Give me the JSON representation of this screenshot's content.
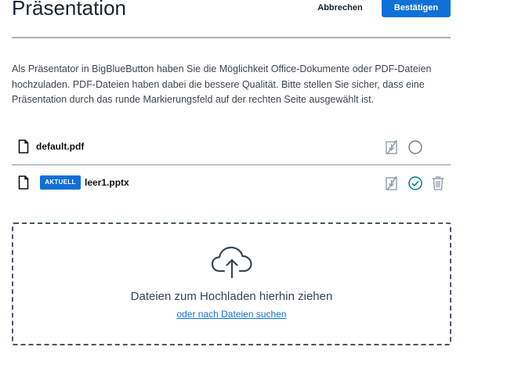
{
  "header": {
    "title": "Präsentation",
    "cancel_label": "Abbrechen",
    "confirm_label": "Bestätigen"
  },
  "intro_text": "Als Präsentator in BigBlueButton haben Sie die Möglichkeit Office-Dokumente oder PDF-Dateien hochzuladen. PDF-Dateien haben dabei die bessere Qualität. Bitte stellen Sie sicher, dass eine Präsentation durch das runde Markierungsfeld auf der rechten Seite ausgewählt ist.",
  "files": [
    {
      "name": "default.pdf",
      "current": false,
      "icons": [
        "file-icon",
        "download-disabled-icon",
        "radio-empty-icon"
      ]
    },
    {
      "name": "leer1.pptx",
      "current": true,
      "badge": "AKTUELL",
      "icons": [
        "file-icon",
        "download-disabled-icon",
        "check-circle-icon",
        "trash-icon"
      ]
    }
  ],
  "dropzone": {
    "main_text": "Dateien zum Hochladen hierhin ziehen",
    "link_text": "oder nach Dateien suchen",
    "icon": "cloud-upload-icon"
  },
  "colors": {
    "accent": "#0f70d7",
    "success": "#008081",
    "text": "#1c2530",
    "muted_icon": "#8b98a5"
  }
}
